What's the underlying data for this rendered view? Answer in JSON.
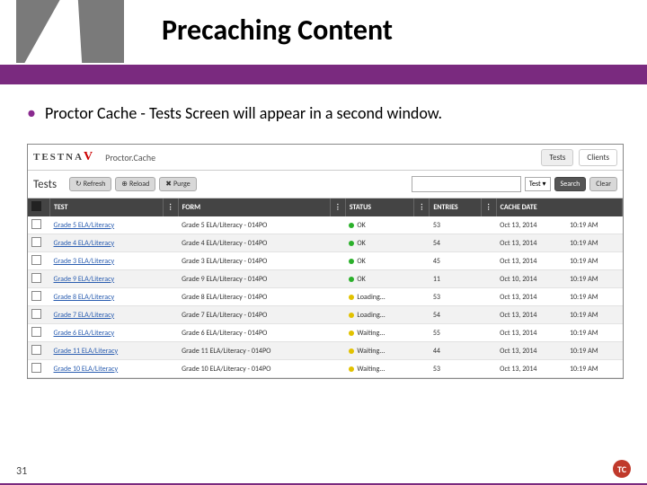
{
  "title": "Precaching Content",
  "bullet": "Proctor Cache - Tests Screen will appear in a second window.",
  "page_number": "31",
  "badge": "TC",
  "brand_text": "TESTNA",
  "brand_v": "V",
  "proctor_cache_label": "Proctor.Cache",
  "tabs": {
    "tests": "Tests",
    "clients": "Clients"
  },
  "section_label": "Tests",
  "buttons": {
    "refresh": "Refresh",
    "reload": "Reload",
    "purge": "Purge",
    "search": "Search",
    "clear": "Clear"
  },
  "filter_select": "Test",
  "columns": {
    "test": "TEST",
    "form": "FORM",
    "status": "STATUS",
    "entries": "ENTRIES",
    "cache": "CACHE DATE"
  },
  "rows": [
    {
      "test": "Grade 5 ELA/Literacy",
      "form": "Grade 5 ELA/Literacy - 014PO",
      "status": "OK",
      "dot": "green",
      "entries": "53",
      "d": "Oct 13, 2014",
      "t": "10:19 AM",
      "alt": false
    },
    {
      "test": "Grade 4 ELA/Literacy",
      "form": "Grade 4 ELA/Literacy - 014PO",
      "status": "OK",
      "dot": "green",
      "entries": "54",
      "d": "Oct 13, 2014",
      "t": "10:19 AM",
      "alt": true
    },
    {
      "test": "Grade 3 ELA/Literacy",
      "form": "Grade 3 ELA/Literacy - 014PO",
      "status": "OK",
      "dot": "green",
      "entries": "45",
      "d": "Oct 13, 2014",
      "t": "10:19 AM",
      "alt": false
    },
    {
      "test": "Grade 9 ELA/Literacy",
      "form": "Grade 9 ELA/Literacy - 014PO",
      "status": "OK",
      "dot": "green",
      "entries": "11",
      "d": "Oct 10, 2014",
      "t": "10:19 AM",
      "alt": true
    },
    {
      "test": "Grade 8 ELA/Literacy",
      "form": "Grade 8 ELA/Literacy - 014PO",
      "status": "Loading...",
      "dot": "yellow",
      "entries": "53",
      "d": "Oct 13, 2014",
      "t": "10:19 AM",
      "alt": false
    },
    {
      "test": "Grade 7 ELA/Literacy",
      "form": "Grade 7 ELA/Literacy - 014PO",
      "status": "Loading...",
      "dot": "yellow",
      "entries": "54",
      "d": "Oct 13, 2014",
      "t": "10:19 AM",
      "alt": true
    },
    {
      "test": "Grade 6 ELA/Literacy",
      "form": "Grade 6 ELA/Literacy - 014PO",
      "status": "Waiting...",
      "dot": "yellow",
      "entries": "55",
      "d": "Oct 13, 2014",
      "t": "10:19 AM",
      "alt": false
    },
    {
      "test": "Grade 11 ELA/Literacy",
      "form": "Grade 11 ELA/Literacy - 014PO",
      "status": "Waiting...",
      "dot": "yellow",
      "entries": "44",
      "d": "Oct 13, 2014",
      "t": "10:19 AM",
      "alt": true
    },
    {
      "test": "Grade 10 ELA/Literacy",
      "form": "Grade 10 ELA/Literacy - 014PO",
      "status": "Waiting...",
      "dot": "yellow",
      "entries": "53",
      "d": "Oct 13, 2014",
      "t": "10:19 AM",
      "alt": false
    }
  ]
}
